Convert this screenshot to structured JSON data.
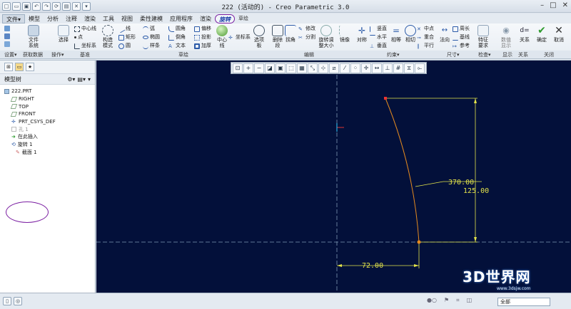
{
  "window": {
    "title": "222 (活动的) - Creo Parametric 3.0"
  },
  "tabs": [
    {
      "label": "文件▾",
      "kind": "file"
    },
    {
      "label": "模型"
    },
    {
      "label": "分析"
    },
    {
      "label": "注释"
    },
    {
      "label": "渲染"
    },
    {
      "label": "工具"
    },
    {
      "label": "视图"
    },
    {
      "label": "柔性建模"
    },
    {
      "label": "应用程序"
    },
    {
      "label": "渲染"
    },
    {
      "label": "旋转",
      "kind": "active"
    },
    {
      "label": "草绘",
      "kind": "sub"
    }
  ],
  "ribbon": {
    "setup": {
      "file_system": "文件\n系统"
    },
    "datum": {
      "select": "选择",
      "center_line": "中心线",
      "point": "点",
      "coord": "坐标系"
    },
    "sketch": {
      "palette": "构造\n模式",
      "line": "线",
      "rect": "矩形",
      "circle": "圆",
      "arc": "弧",
      "ellipse": "椭圆",
      "spline": "样条",
      "fillet": "圆角",
      "chamfer": "倒角",
      "text": "文本",
      "offset": "偏移",
      "project": "投影",
      "thicken": "加厚",
      "center": "中心\n线",
      "coordsys": "坐标系"
    },
    "sel": {
      "label": "选项\n板"
    },
    "edit": {
      "delete_seg": "删除\n段",
      "corner": "拐角",
      "modify": "修改",
      "divide": "分割",
      "rotate_resize": "旋转调\n整大小",
      "mirror": "镜像"
    },
    "constrain": {
      "symmetric": "对称",
      "vertical": "竖直",
      "horizontal": "水平",
      "perp": "垂直",
      "equal": "相等",
      "tangent": "相切",
      "midpoint": "中点",
      "coincident": "重合",
      "parallel": "平行"
    },
    "dimension": {
      "normal": "法向",
      "perimeter": "周长",
      "baseline": "基线",
      "reference": "参考"
    },
    "inspect": {
      "feature": "特征\n要求"
    },
    "display": {
      "show": "数值\n显示"
    },
    "relation": {
      "label": "关系"
    },
    "close": {
      "ok": "确定",
      "cancel": "取消"
    }
  },
  "group_labels": {
    "setup": "设置▾",
    "get_data": "获取数据",
    "ops": "操作▾",
    "datum": "基准",
    "sketch": "草绘",
    "edit": "编辑",
    "constrain": "约束▾",
    "dimension": "尺寸▾",
    "inspect": "检查▾",
    "display": "显示",
    "relation": "关系",
    "close": "关闭"
  },
  "panel": {
    "tree_title": "模型树",
    "nodes": [
      {
        "label": "222.PRT",
        "indent": 0
      },
      {
        "label": "RIGHT",
        "indent": 1
      },
      {
        "label": "TOP",
        "indent": 1
      },
      {
        "label": "FRONT",
        "indent": 1
      },
      {
        "label": "PRT_CSYS_DEF",
        "indent": 1
      },
      {
        "label": "孔 1",
        "indent": 1,
        "dim": true
      },
      {
        "label": "在此插入",
        "indent": 1
      },
      {
        "label": "旋转 1",
        "indent": 1
      },
      {
        "label": "截面 1",
        "indent": 2
      }
    ]
  },
  "sketch_dims": {
    "d1": "370.00",
    "d2": "125.00",
    "d3": "72.00"
  },
  "status": {
    "filter": "全部"
  },
  "watermark": {
    "main": "3D世界网",
    "sub": "www.3dsjw.com"
  },
  "colors": {
    "canvas": "#03103a",
    "dim": "#e3e34a",
    "geom": "#e58a1f",
    "centerline": "#7f98b4",
    "circle_annotation": "#7b1fa2"
  }
}
